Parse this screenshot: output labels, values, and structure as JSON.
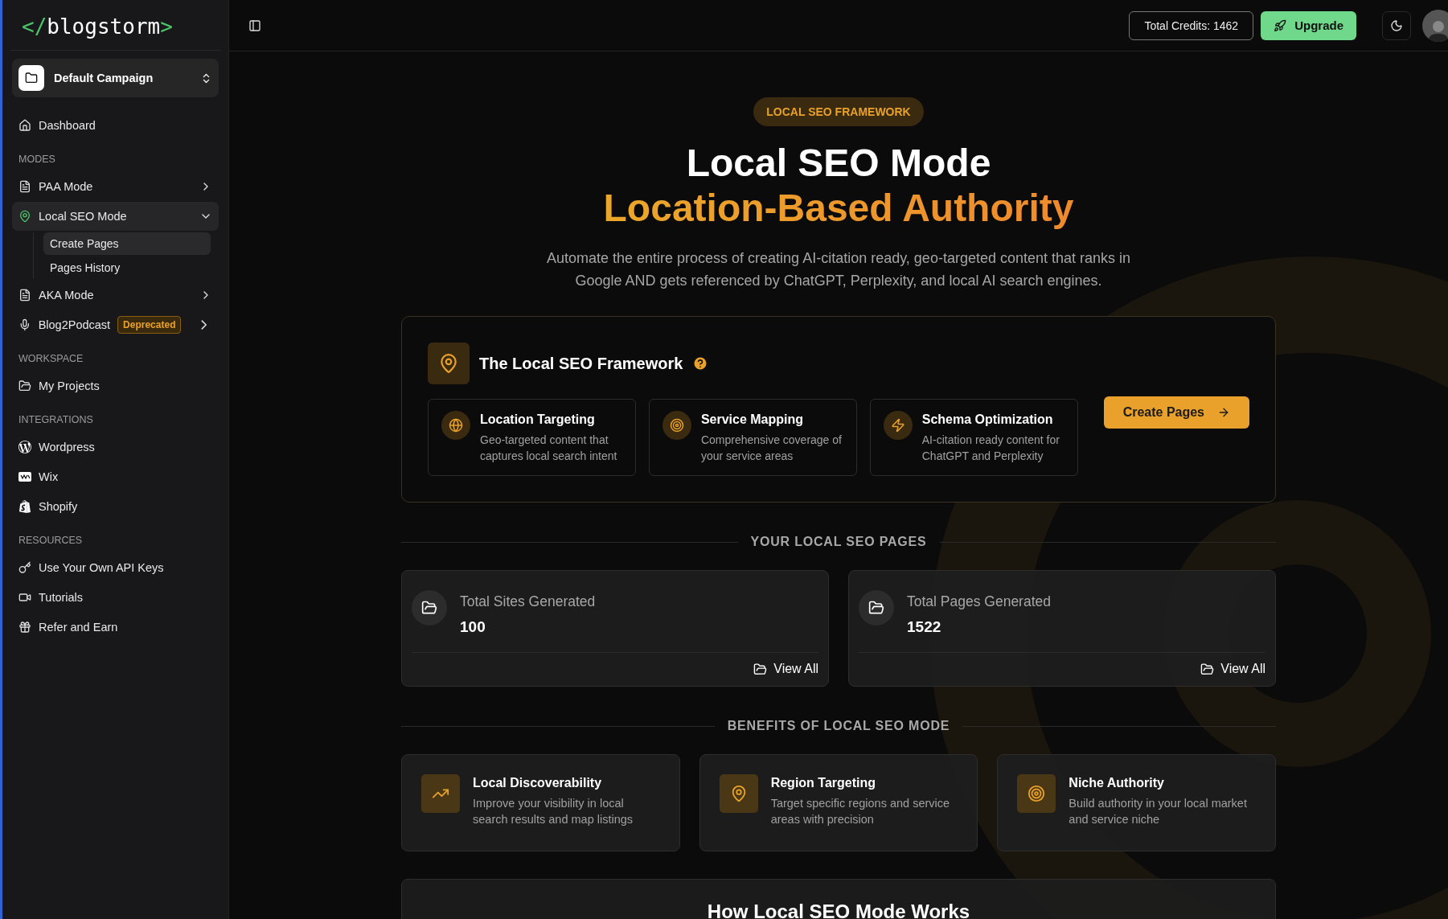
{
  "sidebar": {
    "logo": {
      "open": "</",
      "name": "blogstorm",
      "close": ">"
    },
    "campaign": "Default Campaign",
    "sections": [
      {
        "items": [
          {
            "kind": "link",
            "label": "Dashboard",
            "selected": false
          }
        ]
      },
      {
        "heading": "MODES",
        "items": [
          {
            "kind": "group",
            "label": "PAA Mode",
            "selected": false,
            "expanded": false
          },
          {
            "kind": "group",
            "label": "Local SEO Mode",
            "selected": true,
            "expanded": true,
            "children": [
              {
                "label": "Create Pages",
                "selected": true
              },
              {
                "label": "Pages History",
                "selected": false
              }
            ]
          },
          {
            "kind": "group",
            "label": "AKA Mode",
            "selected": false,
            "expanded": false
          },
          {
            "kind": "group",
            "label": "Blog2Podcast",
            "selected": false,
            "expanded": false,
            "badge": "Deprecated"
          }
        ]
      },
      {
        "heading": "WORKSPACE",
        "items": [
          {
            "kind": "link",
            "label": "My Projects",
            "selected": false
          }
        ]
      },
      {
        "heading": "INTEGRATIONS",
        "items": [
          {
            "kind": "link",
            "label": "Wordpress",
            "selected": false
          },
          {
            "kind": "link",
            "label": "Wix",
            "selected": false
          },
          {
            "kind": "link",
            "label": "Shopify",
            "selected": false
          }
        ]
      },
      {
        "heading": "RESOURCES",
        "items": [
          {
            "kind": "link",
            "label": "Use Your Own API Keys",
            "selected": false
          },
          {
            "kind": "link",
            "label": "Tutorials",
            "selected": false
          },
          {
            "kind": "link",
            "label": "Refer and Earn",
            "selected": false
          }
        ]
      }
    ]
  },
  "topbar": {
    "credits": "Total Credits: 1462",
    "upgrade": "Upgrade"
  },
  "hero": {
    "badge": "LOCAL SEO FRAMEWORK",
    "title": "Local SEO Mode",
    "subtitle": "Location-Based Authority",
    "description": "Automate the entire process of creating AI-citation ready, geo-targeted content that ranks in Google AND gets referenced by ChatGPT, Perplexity, and local AI search engines."
  },
  "framework": {
    "title": "The Local SEO Framework",
    "features": [
      {
        "title": "Location Targeting",
        "description": "Geo-targeted content that captures local search intent"
      },
      {
        "title": "Service Mapping",
        "description": "Comprehensive coverage of your service areas"
      },
      {
        "title": "Schema Optimization",
        "description": "AI-citation ready content for ChatGPT and Perplexity"
      }
    ],
    "button": "Create Pages"
  },
  "pages": {
    "heading": "YOUR LOCAL SEO PAGES",
    "stats": [
      {
        "label": "Total Sites Generated",
        "value": "100",
        "action": "View All"
      },
      {
        "label": "Total Pages Generated",
        "value": "1522",
        "action": "View All"
      }
    ]
  },
  "benefits": {
    "heading": "BENEFITS OF LOCAL SEO MODE",
    "items": [
      {
        "title": "Local Discoverability",
        "description": "Improve your visibility in local search results and map listings"
      },
      {
        "title": "Region Targeting",
        "description": "Target specific regions and service areas with precision"
      },
      {
        "title": "Niche Authority",
        "description": "Build authority in your local market and service niche"
      }
    ]
  },
  "how": {
    "title": "How Local SEO Mode Works"
  }
}
